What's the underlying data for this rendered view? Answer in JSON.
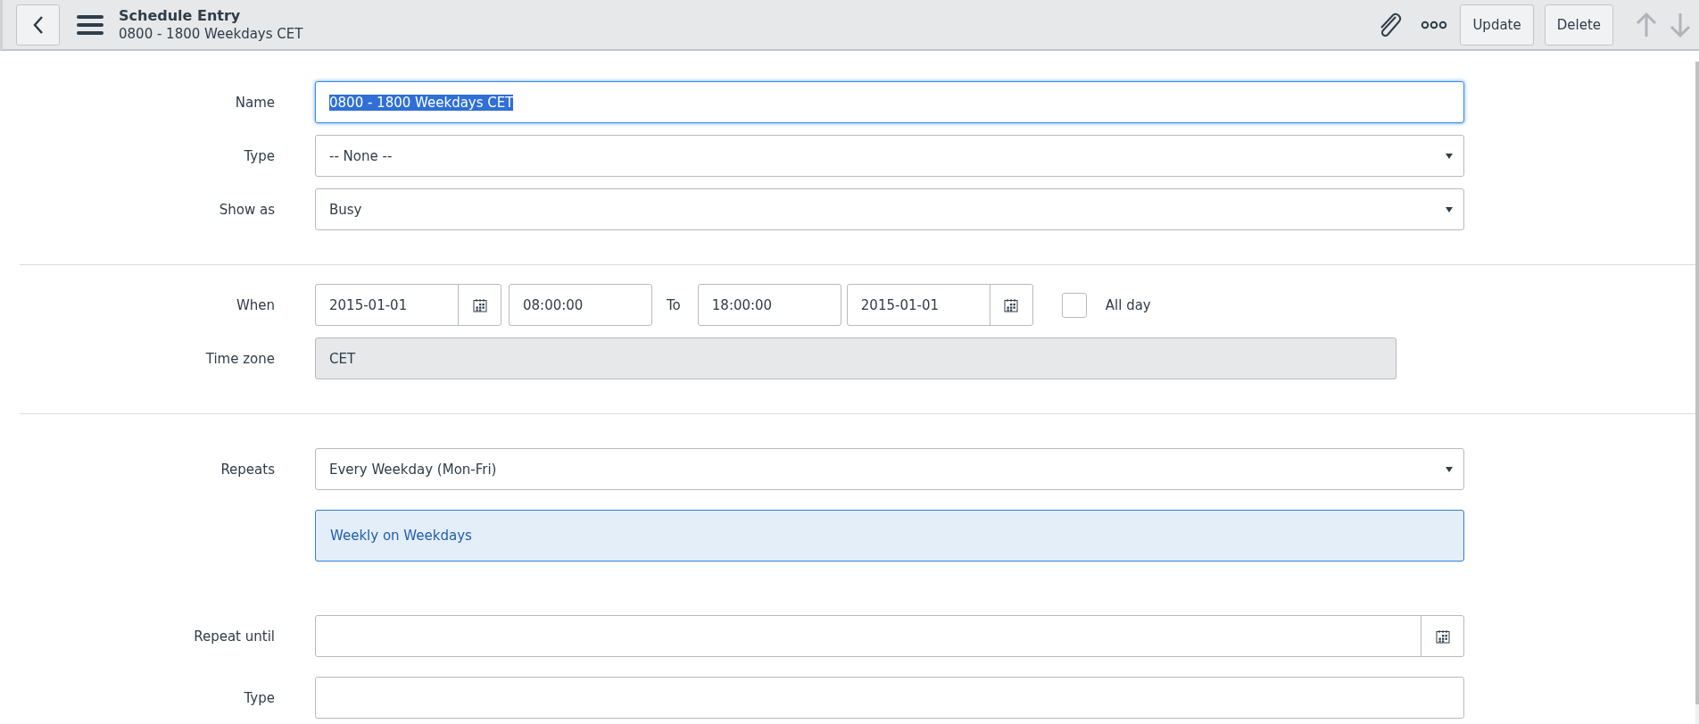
{
  "header": {
    "title": "Schedule Entry",
    "subtitle": "0800 - 1800 Weekdays CET",
    "buttons": [
      "Update",
      "Delete"
    ],
    "nav": [
      {
        "kind": "up",
        "disabled": true
      },
      {
        "kind": "down",
        "disabled": true
      }
    ]
  },
  "sections": [
    {
      "rows": [
        {
          "kind": "text",
          "label": "Name",
          "value": "0800 - 1800 Weekdays CET",
          "focused": true,
          "selected_text": true
        },
        {
          "kind": "select",
          "label": "Type",
          "value": "-- None --"
        },
        {
          "kind": "select",
          "label": "Show as",
          "value": "Busy"
        }
      ]
    },
    {
      "rows": [
        {
          "kind": "when",
          "label": "When",
          "start_date": "2015-01-01",
          "start_time": "08:00:00",
          "to_label": "To",
          "end_time": "18:00:00",
          "end_date": "2015-01-01",
          "all_day": {
            "label": "All day",
            "checked": false
          }
        },
        {
          "kind": "readonly",
          "label": "Time zone",
          "value": "CET"
        }
      ]
    },
    {
      "rows": [
        {
          "kind": "select",
          "label": "Repeats",
          "value": "Every Weekday (Mon-Fri)"
        },
        {
          "kind": "info",
          "value": "Weekly on Weekdays"
        },
        {
          "kind": "date",
          "label": "Repeat until",
          "value": ""
        },
        {
          "kind": "blank",
          "label": "Type"
        }
      ]
    }
  ]
}
